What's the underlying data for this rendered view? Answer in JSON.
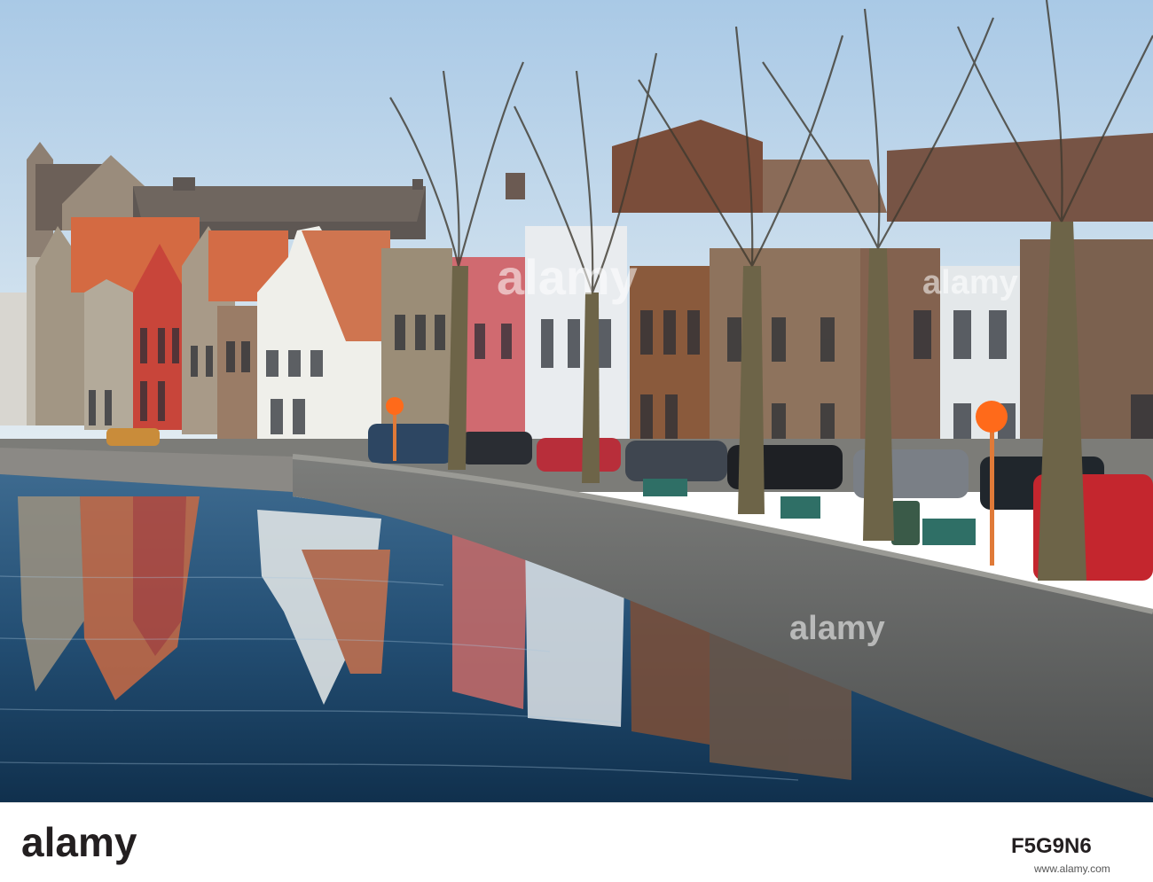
{
  "image": {
    "kind": "stock-photo",
    "description_words": [
      "canal",
      "gabled houses",
      "reflection",
      "bare trees",
      "parked cars"
    ]
  },
  "watermarks": {
    "logo_text": "alamy",
    "image_id": "F5G9N6",
    "url": "www.alamy.com"
  },
  "palette": {
    "sky_top": "#b9d4ea",
    "sky_bottom": "#e6eef3",
    "water": "#1f4a6e",
    "wall": "#6a6c6c",
    "orange_roof": "#d46a42",
    "red_house": "#c8453a",
    "white_house": "#f0f0f0",
    "brick": "#8a5a3c",
    "brand": "#231f20"
  }
}
